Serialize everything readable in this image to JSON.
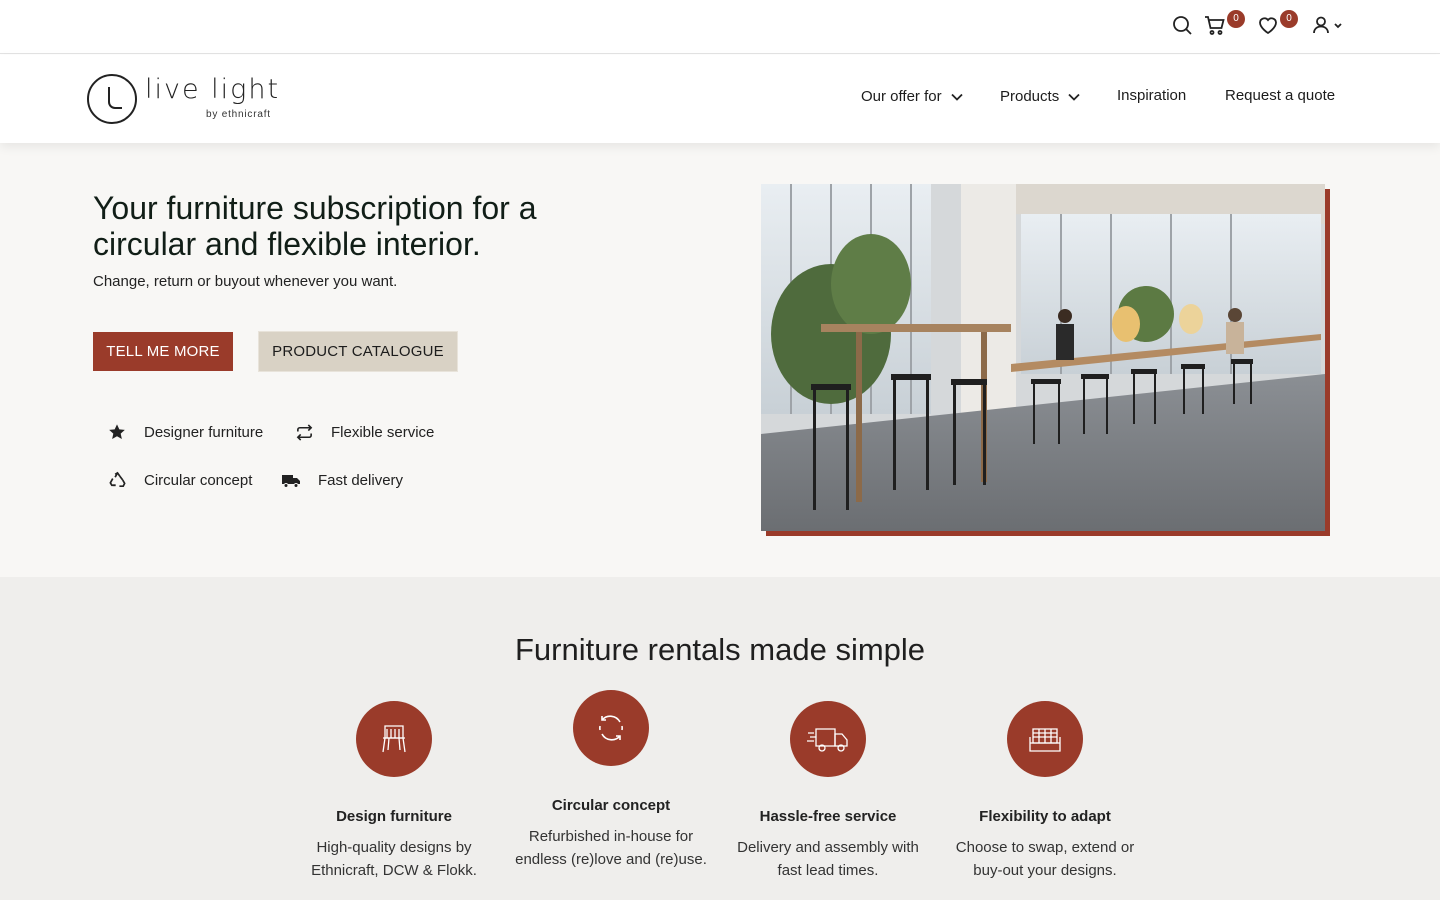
{
  "utility": {
    "cart_count": "0",
    "wishlist_count": "0",
    "icons": [
      "search-icon",
      "cart-icon",
      "heart-icon",
      "user-icon",
      "chevron-down-icon"
    ]
  },
  "logo": {
    "word": "live light",
    "sub": "by ethnicraft"
  },
  "nav": {
    "items": [
      {
        "label": "Our offer for",
        "dropdown": true
      },
      {
        "label": "Products",
        "dropdown": true
      },
      {
        "label": "Inspiration",
        "dropdown": false
      },
      {
        "label": "Request a quote",
        "dropdown": false
      }
    ]
  },
  "hero": {
    "title": "Your furniture subscription for a circular and flexible interior.",
    "subtitle": "Change, return or buyout whenever you want.",
    "primary_button": "TELL ME MORE",
    "secondary_button": "PRODUCT CATALOGUE",
    "features": [
      {
        "label": "Designer furniture",
        "icon": "star-icon"
      },
      {
        "label": "Flexible service",
        "icon": "repeat-icon"
      },
      {
        "label": "Circular concept",
        "icon": "recycle-icon"
      },
      {
        "label": "Fast delivery",
        "icon": "truck-icon"
      }
    ]
  },
  "section2": {
    "title": "Furniture rentals made simple",
    "cards": [
      {
        "icon": "chair-icon",
        "title": "Design furniture",
        "text": "High-quality designs by Ethnicraft, DCW & Flokk."
      },
      {
        "icon": "circular-arrows-icon",
        "title": "Circular concept",
        "text": "Refurbished in-house for endless (re)love and (re)use."
      },
      {
        "icon": "truck-icon",
        "title": "Hassle-free service",
        "text": "Delivery and assembly with fast lead times."
      },
      {
        "icon": "sofa-icon",
        "title": "Flexibility to adapt",
        "text": "Choose to swap, extend or buy-out your designs."
      }
    ]
  },
  "colors": {
    "accent": "#9a3b2a",
    "secondary_button": "#d9d2c5",
    "hero_bg": "#f8f7f5",
    "section_bg": "#efeeec"
  }
}
